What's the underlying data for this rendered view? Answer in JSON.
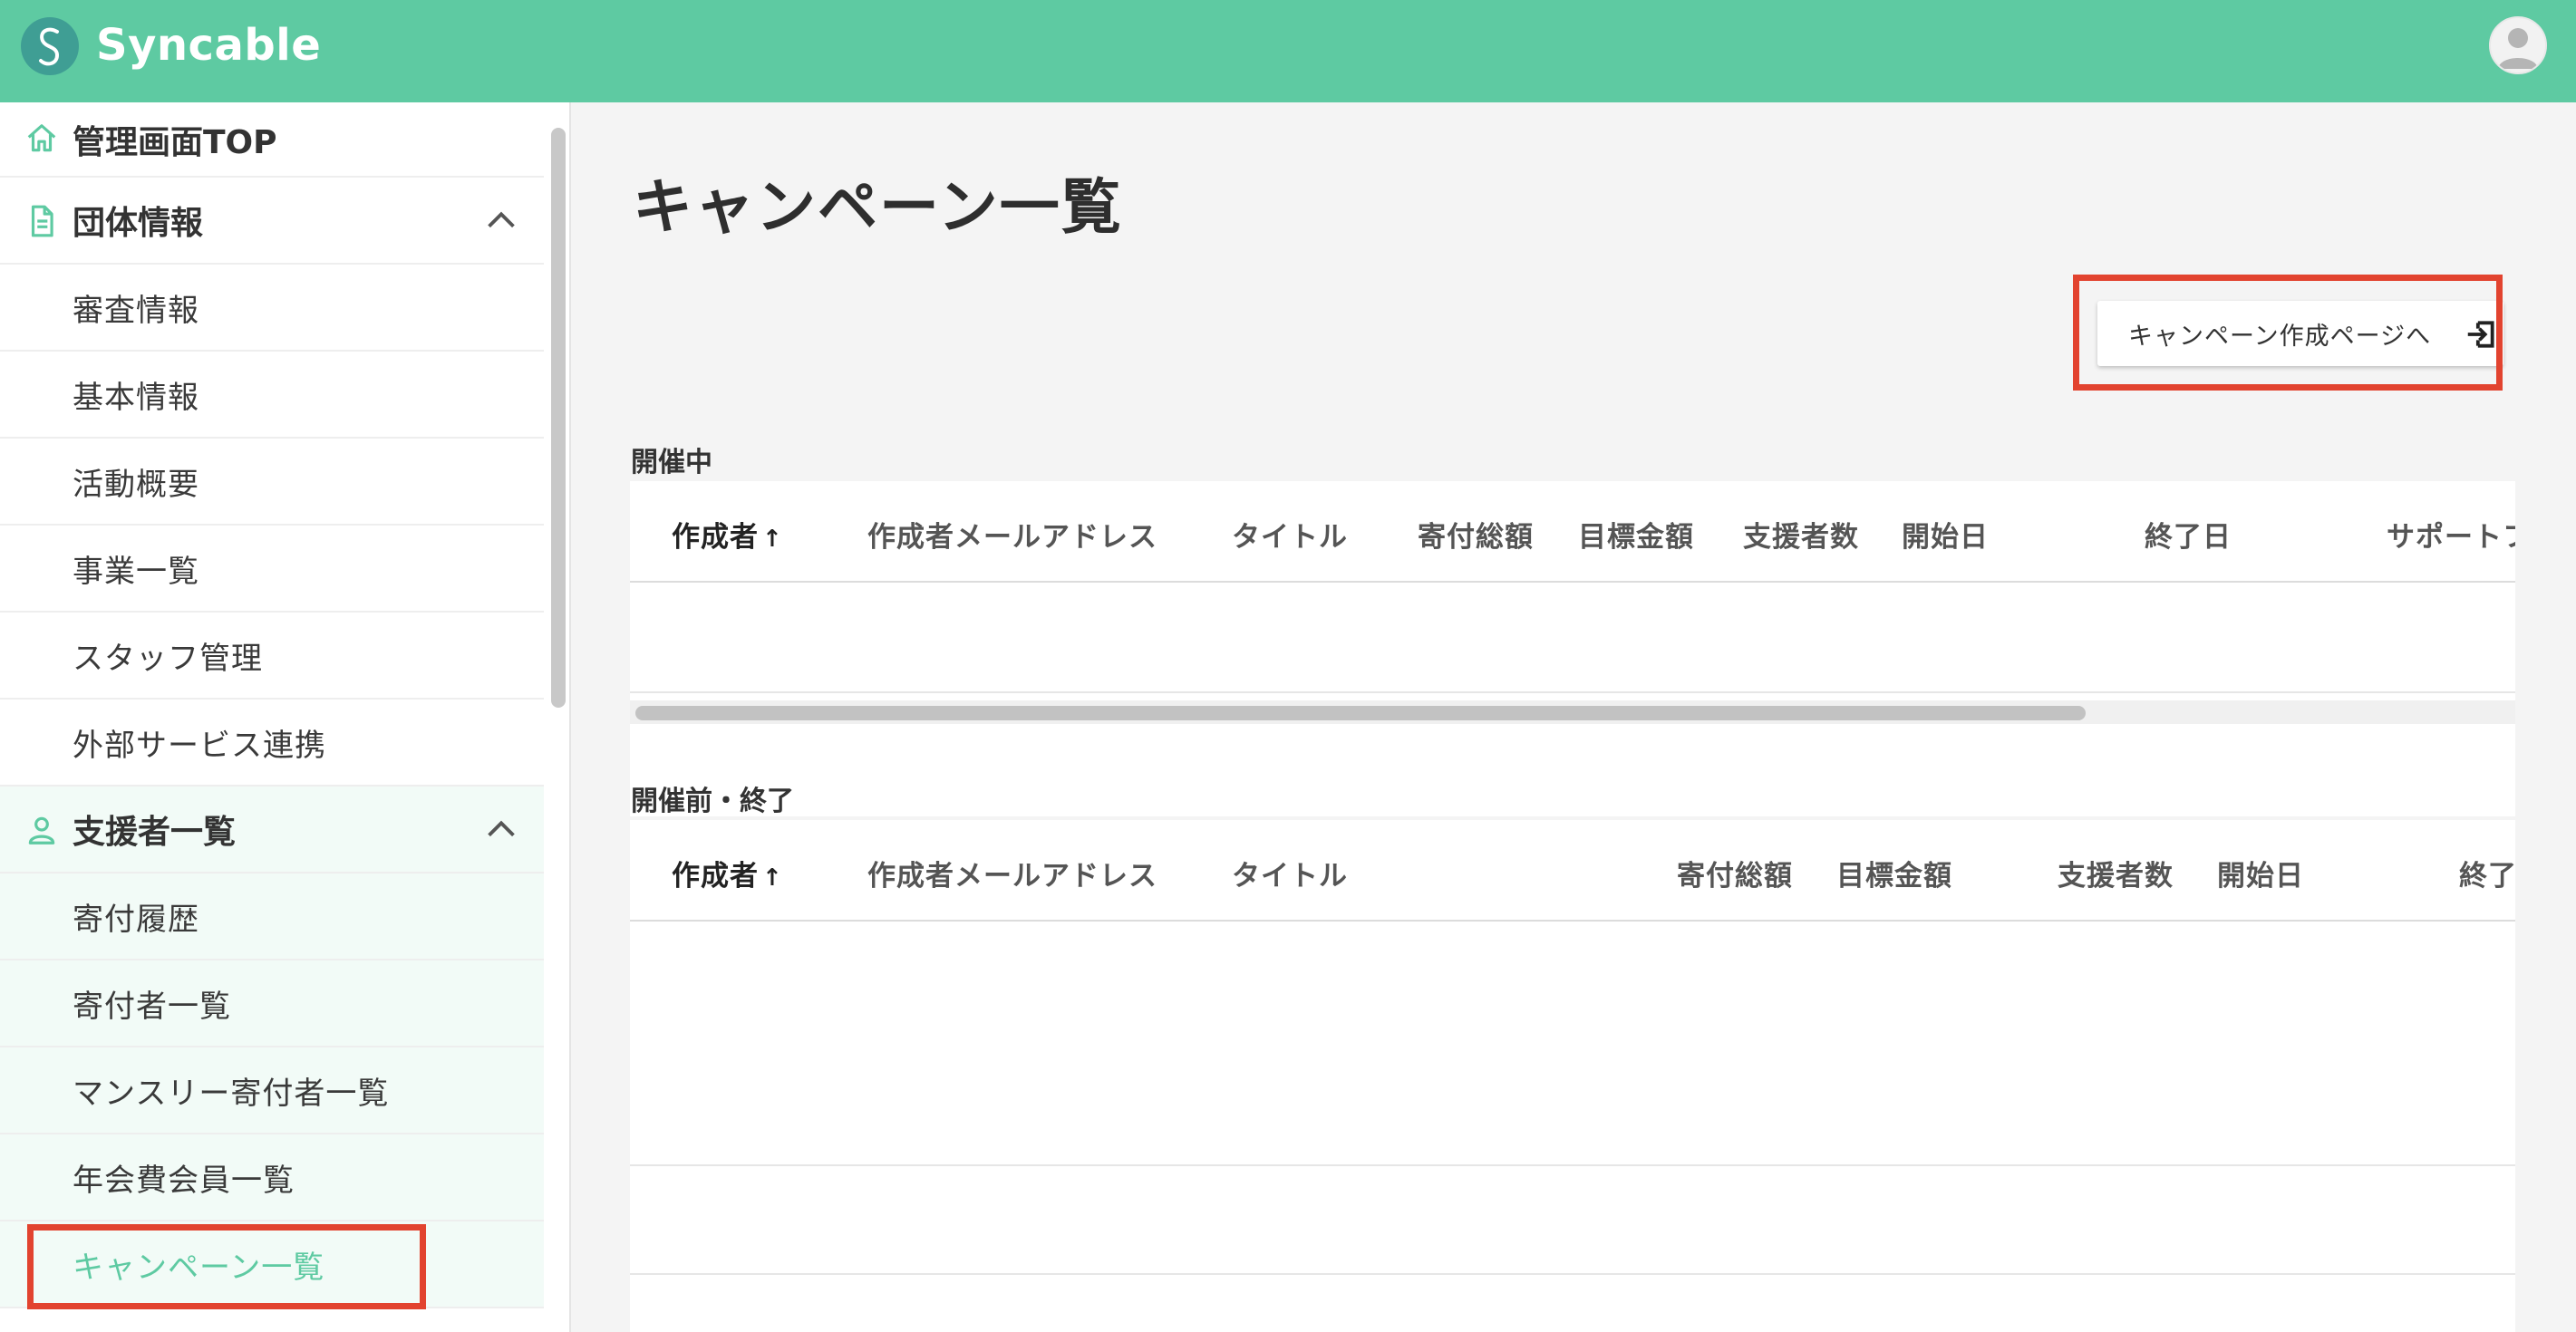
{
  "header": {
    "brand": "Syncable",
    "colors": {
      "bar": "#5ecaa2",
      "logo": "#3f9e94"
    }
  },
  "sidebar": {
    "top": {
      "label": "管理画面TOP",
      "icon": "home-icon"
    },
    "org_section": {
      "label": "団体情報",
      "icon": "document-icon",
      "items": [
        "審査情報",
        "基本情報",
        "活動概要",
        "事業一覧",
        "スタッフ管理",
        "外部サービス連携"
      ]
    },
    "supporter_section": {
      "label": "支援者一覧",
      "icon": "person-icon",
      "items": [
        "寄付履歴",
        "寄付者一覧",
        "マンスリー寄付者一覧",
        "年会費会員一覧",
        "キャンペーン一覧"
      ],
      "active_item": "キャンペーン一覧"
    }
  },
  "main": {
    "title": "キャンペーン一覧",
    "create_button": "キャンペーン作成ページへ",
    "ongoing": {
      "label": "開催中",
      "columns": [
        "作成者",
        "作成者メールアドレス",
        "タイトル",
        "寄付総額",
        "目標金額",
        "支援者数",
        "開始日",
        "終了日",
        "サポートフ"
      ],
      "sort_arrow": "↑"
    },
    "ended": {
      "label": "開催前・終了",
      "columns": [
        "作成者",
        "作成者メールアドレス",
        "タイトル",
        "寄付総額",
        "目標金額",
        "支援者数",
        "開始日",
        "終了"
      ],
      "sort_arrow": "↑"
    }
  },
  "annotations": {
    "highlight_color": "#e2432f"
  }
}
